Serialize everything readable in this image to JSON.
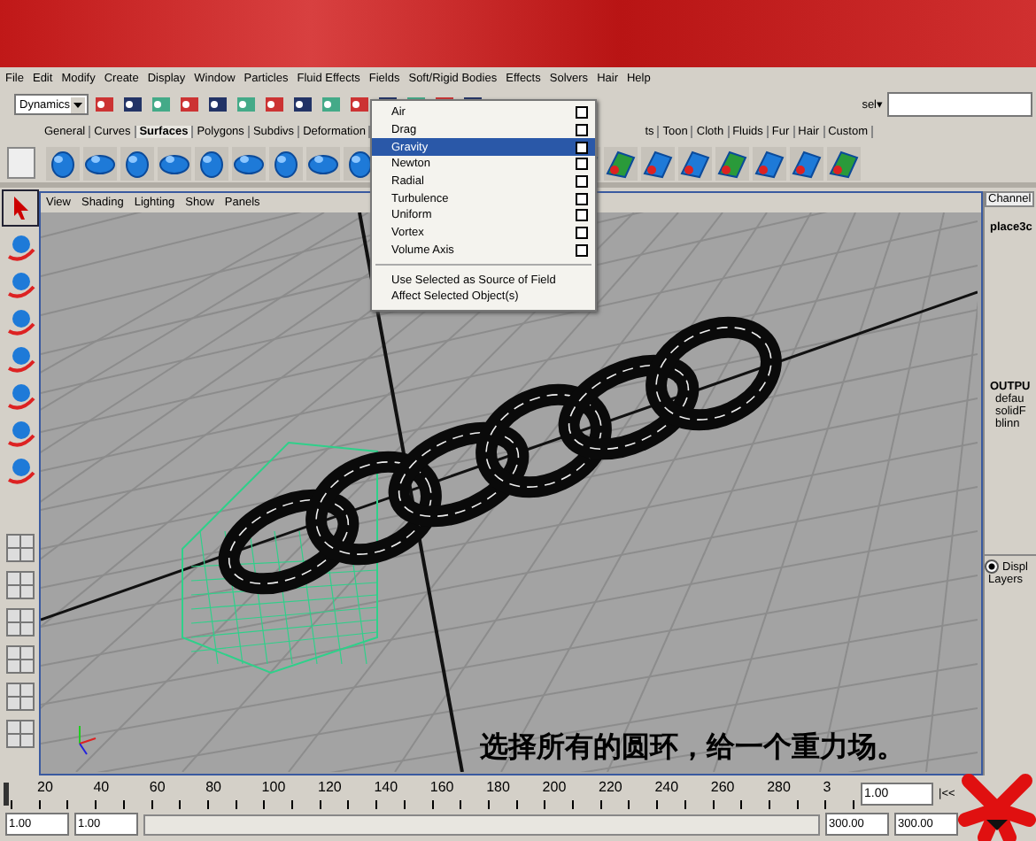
{
  "menu_bar": [
    "File",
    "Edit",
    "Modify",
    "Create",
    "Display",
    "Window",
    "Particles",
    "Fluid Effects",
    "Fields",
    "Soft/Rigid Bodies",
    "Effects",
    "Solvers",
    "Hair",
    "Help"
  ],
  "toolbar": {
    "mode": "Dynamics",
    "sel_label": "sel▾"
  },
  "shelf_tabs": [
    {
      "label": "General",
      "selected": false
    },
    {
      "label": "Curves",
      "selected": false
    },
    {
      "label": "Surfaces",
      "selected": true
    },
    {
      "label": "Polygons",
      "selected": false
    },
    {
      "label": "Subdivs",
      "selected": false
    },
    {
      "label": "Deformation",
      "selected": false
    },
    {
      "label": "ts",
      "selected": false
    },
    {
      "label": "Toon",
      "selected": false
    },
    {
      "label": "Cloth",
      "selected": false
    },
    {
      "label": "Fluids",
      "selected": false
    },
    {
      "label": "Fur",
      "selected": false
    },
    {
      "label": "Hair",
      "selected": false
    },
    {
      "label": "Custom",
      "selected": false
    }
  ],
  "fields_menu": {
    "items": [
      {
        "label": "Air",
        "kind": "option",
        "selected": false
      },
      {
        "label": "Drag",
        "kind": "option",
        "selected": false
      },
      {
        "label": "Gravity",
        "kind": "option",
        "selected": true
      },
      {
        "label": "Newton",
        "kind": "option",
        "selected": false
      },
      {
        "label": "Radial",
        "kind": "option",
        "selected": false
      },
      {
        "label": "Turbulence",
        "kind": "option",
        "selected": false
      },
      {
        "label": "Uniform",
        "kind": "option",
        "selected": false
      },
      {
        "label": "Vortex",
        "kind": "option",
        "selected": false
      },
      {
        "label": "Volume Axis",
        "kind": "option",
        "selected": false
      },
      {
        "label": "Use Selected as Source of Field",
        "kind": "plain",
        "selected": false
      },
      {
        "label": "Affect Selected Object(s)",
        "kind": "plain",
        "selected": false
      }
    ]
  },
  "viewport": {
    "menu": [
      "View",
      "Shading",
      "Lighting",
      "Show",
      "Panels"
    ],
    "caption": "选择所有的圆环，给一个重力场。"
  },
  "channel_box": {
    "tab": "Channel",
    "object": "place3c",
    "outputs_heading": "OUTPU",
    "outputs": [
      "defau",
      "solidF",
      "blinn"
    ],
    "display_radio": "Displ",
    "display_selected": true,
    "layers_menu": "Layers"
  },
  "timeline": {
    "ticks": [
      "20",
      "40",
      "60",
      "80",
      "100",
      "120",
      "140",
      "160",
      "180",
      "200",
      "220",
      "240",
      "260",
      "280",
      "3"
    ],
    "level": 0,
    "current_time": "1.00",
    "jump_button": "|<<"
  },
  "range": {
    "start": "1.00",
    "playback_start": "1.00",
    "level": 1,
    "playback_end": "300.00",
    "end": "300.00"
  }
}
